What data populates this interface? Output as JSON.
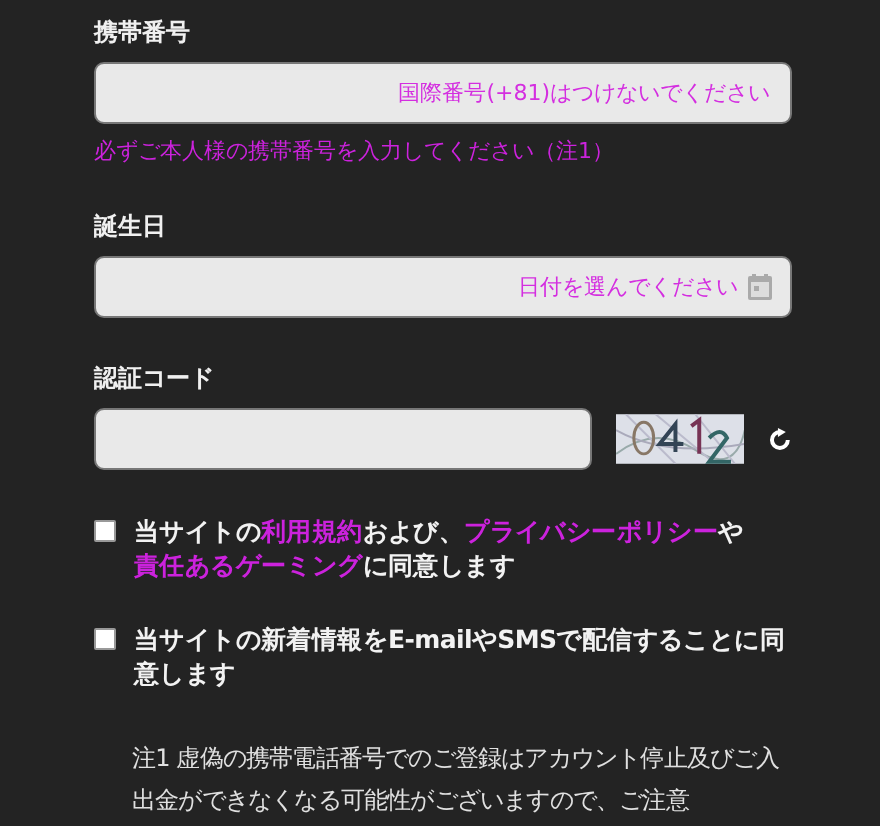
{
  "fields": [
    {
      "label": "携帯番号",
      "kind": "text",
      "placeholder": "国際番号(+81)はつけないでください",
      "note": "必ずご本人様の携帯番号を入力してください（注1）"
    },
    {
      "label": "誕生日",
      "kind": "date",
      "placeholder": "日付を選んでください"
    },
    {
      "label": "認証コード",
      "kind": "captcha"
    }
  ],
  "agreements": [
    {
      "checked": false,
      "segments": [
        {
          "kind": "plain",
          "text": "当サイトの"
        },
        {
          "kind": "link",
          "text": "利用規約"
        },
        {
          "kind": "plain",
          "text": "および、"
        },
        {
          "kind": "link",
          "text": "プライバシーポリシー"
        },
        {
          "kind": "plain",
          "text": "や"
        },
        {
          "kind": "link",
          "text": "責任あるゲーミング"
        },
        {
          "kind": "plain",
          "text": "に同意します"
        }
      ]
    },
    {
      "checked": false,
      "segments": [
        {
          "kind": "plain",
          "text": "当サイトの新着情報をE-mailやSMSで配信することに同意します"
        }
      ]
    }
  ],
  "footnote": "注1 虚偽の携帯電話番号でのご登録はアカウント停止及びご入出金ができなくなる可能性がございますので、ご注意"
}
